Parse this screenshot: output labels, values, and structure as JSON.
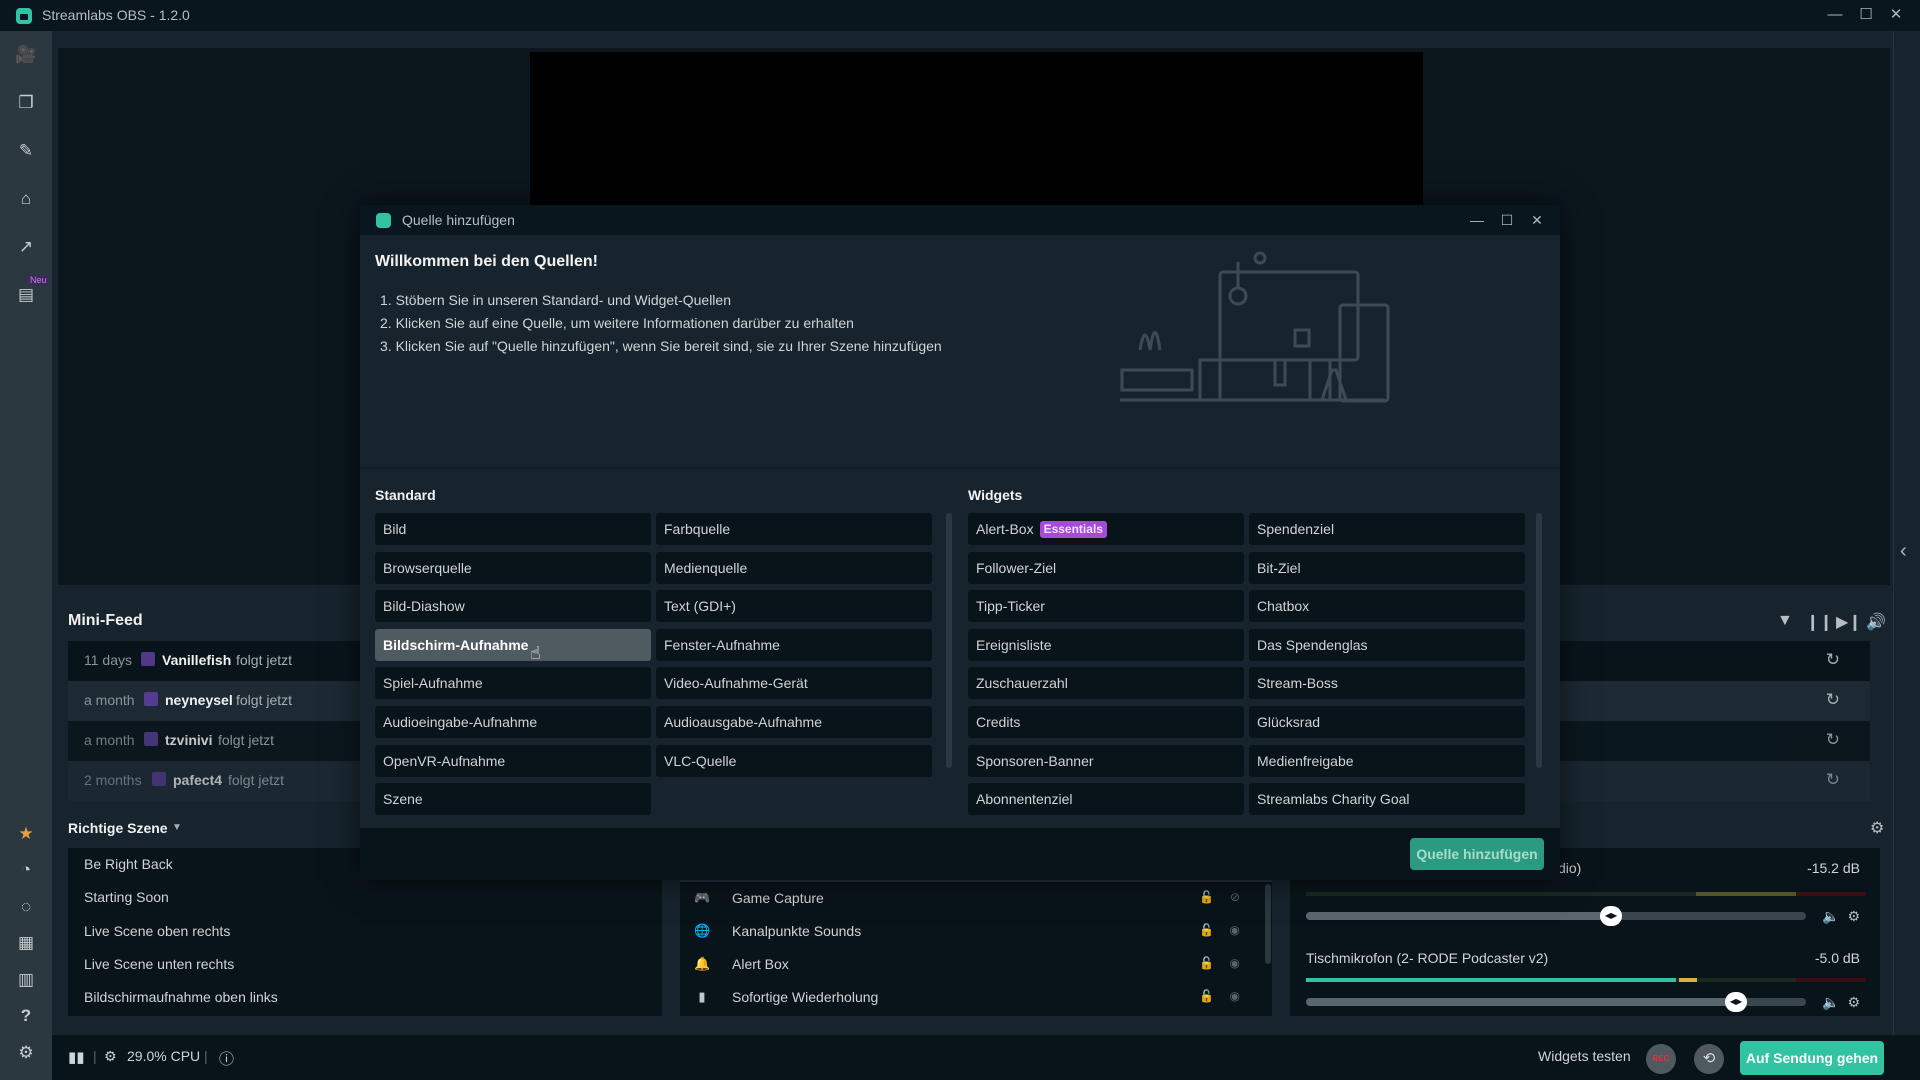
{
  "app": {
    "title": "Streamlabs OBS - 1.2.0",
    "window_controls": {
      "minimize": "—",
      "maximize": "☐",
      "close": "✕"
    }
  },
  "sidebar": {
    "top_items": [
      {
        "name": "editor",
        "icon": "video-camera-icon",
        "glyph": "🎥"
      },
      {
        "name": "layout",
        "icon": "layers-icon",
        "glyph": "❐"
      },
      {
        "name": "themes",
        "icon": "puzzle-icon",
        "glyph": "✎"
      },
      {
        "name": "store",
        "icon": "store-icon",
        "glyph": "⌂"
      },
      {
        "name": "analytics",
        "icon": "chart-icon",
        "glyph": "↗"
      },
      {
        "name": "highlighter",
        "icon": "clapperboard-icon",
        "glyph": "▤"
      }
    ],
    "new_badge": "Neu",
    "bottom_items": [
      {
        "name": "prime",
        "icon": "prime-star-icon",
        "glyph": "★"
      },
      {
        "name": "dashboard",
        "icon": "gauge-icon",
        "glyph": "◔"
      },
      {
        "name": "cloudbot",
        "icon": "chat-icon",
        "glyph": "◌"
      },
      {
        "name": "layout-editor",
        "icon": "grid-icon",
        "glyph": "▦"
      },
      {
        "name": "studio-mode",
        "icon": "columns-icon",
        "glyph": "▥"
      },
      {
        "name": "help",
        "icon": "help-icon",
        "glyph": "?"
      },
      {
        "name": "settings",
        "icon": "gear-icon",
        "glyph": "⚙"
      }
    ]
  },
  "minifeed": {
    "title": "Mini-Feed",
    "tools": {
      "filter": "▼",
      "pause": "❙❙",
      "skip": "▶❙",
      "volume": "🔊"
    },
    "items": [
      {
        "time": "11 days",
        "user": "Vanillefish",
        "action": "folgt jetzt"
      },
      {
        "time": "a month",
        "user": "neyneysel",
        "action": "folgt jetzt"
      },
      {
        "time": "a month",
        "user": "tzvinivi",
        "action": "folgt jetzt"
      },
      {
        "time": "2 months",
        "user": "pafect4",
        "action": "folgt jetzt"
      }
    ],
    "replay_glyph": "↻"
  },
  "scenes": {
    "collection": "Richtige Szene",
    "caret": "▼",
    "items": [
      "Be Right Back",
      "Starting Soon",
      "Live Scene oben rechts",
      "Live Scene unten rechts",
      "Bildschirmaufnahme oben links"
    ]
  },
  "sources": {
    "items": [
      {
        "label": "Game Capture",
        "icon": "gamepad-icon",
        "glyph": "🎮",
        "visible": false
      },
      {
        "label": "Kanalpunkte Sounds",
        "icon": "globe-icon",
        "glyph": "🌐",
        "visible": true
      },
      {
        "label": "Alert Box",
        "icon": "bell-icon",
        "glyph": "🔔",
        "visible": true
      },
      {
        "label": "Sofortige Wiederholung",
        "icon": "file-video-icon",
        "glyph": "▮",
        "visible": true
      }
    ],
    "lock_glyph": "🔓",
    "eye_glyph": "◉",
    "eye_off_glyph": "⊘"
  },
  "mixer": {
    "channels": [
      {
        "name": "dio)",
        "db": "-15.2 dB",
        "level": 0.0,
        "volume": 0.61
      },
      {
        "name": "Tischmikrofon (2- RODE Podcaster v2)",
        "db": "-5.0 dB",
        "level": 0.66,
        "volume": 0.86
      }
    ],
    "mute_glyph": "🔈",
    "gear_glyph": "⚙"
  },
  "statusbar": {
    "cpu": "29.0% CPU",
    "widgets_test": "Widgets testen",
    "rec": "REC",
    "replay_glyph": "⟲",
    "go_live": "Auf Sendung gehen"
  },
  "dialog": {
    "title": "Quelle hinzufügen",
    "welcome": "Willkommen bei den Quellen!",
    "steps": [
      "1. Stöbern Sie in unseren Standard- und Widget-Quellen",
      "2. Klicken Sie auf eine Quelle, um weitere Informationen darüber zu erhalten",
      "3. Klicken Sie auf \"Quelle hinzufügen\", wenn Sie bereit sind, sie zu Ihrer Szene hinzufügen"
    ],
    "standard_title": "Standard",
    "standard": [
      "Bild",
      "Farbquelle",
      "Browserquelle",
      "Medienquelle",
      "Bild-Diashow",
      "Text (GDI+)",
      "Bildschirm-Aufnahme",
      "Fenster-Aufnahme",
      "Spiel-Aufnahme",
      "Video-Aufnahme-Gerät",
      "Audioeingabe-Aufnahme",
      "Audioausgabe-Aufnahme",
      "OpenVR-Aufnahme",
      "VLC-Quelle",
      "Szene"
    ],
    "selected": "Bildschirm-Aufnahme",
    "widgets_title": "Widgets",
    "widgets": [
      "Alert-Box",
      "Spendenziel",
      "Follower-Ziel",
      "Bit-Ziel",
      "Tipp-Ticker",
      "Chatbox",
      "Ereignisliste",
      "Das Spendenglas",
      "Zuschauerzahl",
      "Stream-Boss",
      "Credits",
      "Glücksrad",
      "Sponsoren-Banner",
      "Medienfreigabe",
      "Abonnentenziel",
      "Streamlabs Charity Goal"
    ],
    "essentials_badge": "Essentials",
    "add_button": "Quelle hinzufügen"
  },
  "colors": {
    "accent": "#31c3a2",
    "essentials": "#a54bd6",
    "twitch": "#6441a5",
    "rec": "#e0343e"
  }
}
